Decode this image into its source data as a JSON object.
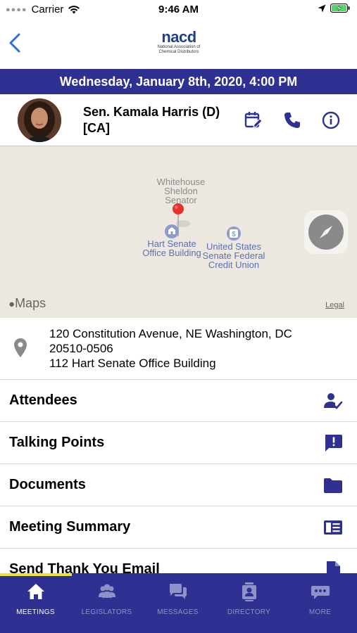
{
  "status_bar": {
    "carrier": "Carrier",
    "time": "9:46 AM"
  },
  "header": {
    "logo_word": "nacd",
    "logo_subtitle": "National Association of Chemical Distributors"
  },
  "meeting": {
    "date_time": "Wednesday, January 8th, 2020, 4:00 PM",
    "legislator": "Sen. Kamala Harris (D) [CA]"
  },
  "map": {
    "labels": {
      "whitehouse": "Whitehouse Sheldon Senator",
      "hart": "Hart Senate Office Building",
      "credit_union": "United States Senate Federal Credit Union"
    },
    "brand": "Maps",
    "legal": "Legal"
  },
  "address": {
    "line1": "120 Constitution Avenue, NE Washington, DC",
    "line2": "20510-0506",
    "line3": "112 Hart Senate Office Building"
  },
  "menu": {
    "items": [
      {
        "label": "Attendees",
        "icon": "attendees-icon"
      },
      {
        "label": "Talking Points",
        "icon": "talking-points-icon"
      },
      {
        "label": "Documents",
        "icon": "folder-icon"
      },
      {
        "label": "Meeting Summary",
        "icon": "summary-icon"
      },
      {
        "label": "Send Thank You Email",
        "icon": "document-icon"
      }
    ]
  },
  "tabs": [
    {
      "label": "MEETINGS",
      "icon": "home-icon",
      "active": true
    },
    {
      "label": "LEGISLATORS",
      "icon": "people-icon",
      "active": false
    },
    {
      "label": "MESSAGES",
      "icon": "chat-icon",
      "active": false
    },
    {
      "label": "DIRECTORY",
      "icon": "contact-card-icon",
      "active": false
    },
    {
      "label": "MORE",
      "icon": "more-icon",
      "active": false
    }
  ],
  "colors": {
    "primary": "#2e3192",
    "accent": "#f2e230",
    "battery": "#4cd964",
    "pin": "#e8312b"
  }
}
